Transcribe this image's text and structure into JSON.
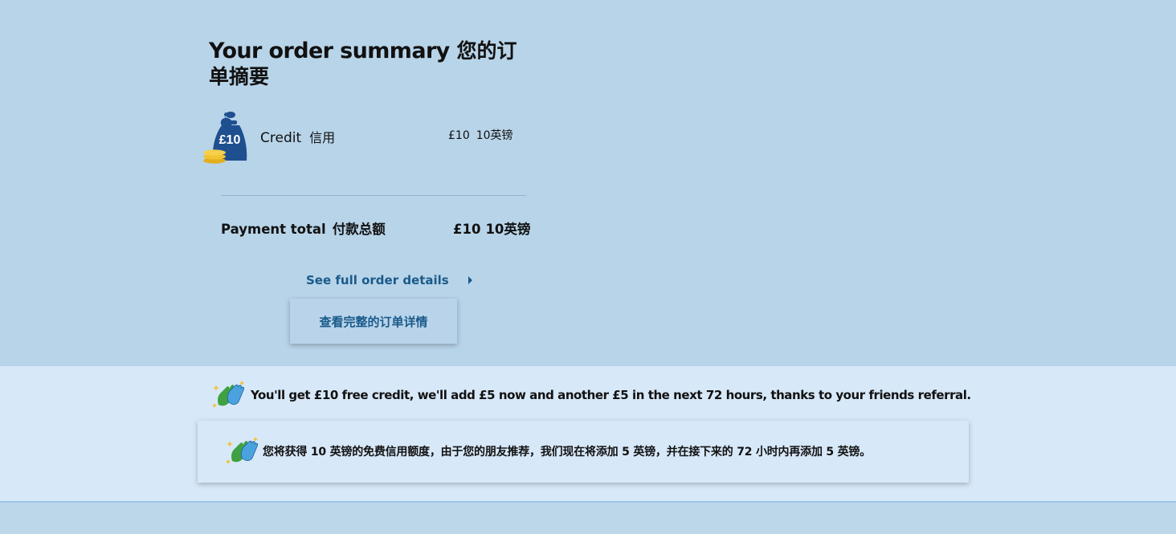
{
  "summary": {
    "title": "Your order summary",
    "title_zh": "您的订单摘要"
  },
  "item": {
    "icon": "money-bag-icon",
    "icon_text": "£10",
    "label": "Credit",
    "label_zh": "信用",
    "price": "£10",
    "price_zh": "10英镑"
  },
  "total": {
    "label": "Payment total",
    "label_zh": "付款总额",
    "value": "£10",
    "value_zh": "10英镑"
  },
  "details": {
    "link_label": "See full order details",
    "link_label_zh": "查看完整的订单详情"
  },
  "banner": {
    "icon": "high-five-icon",
    "message": "You'll get £10 free credit, we'll add £5 now and another £5 in the next 72 hours, thanks to your friends referral.",
    "message_zh": "您将获得 10 英镑的免费信用额度，由于您的朋友推荐，我们现在将添加 5 英镑，并在接下来的 72 小时内再添加 5 英镑。"
  },
  "colors": {
    "background": "#b8d4e9",
    "banner_background": "#d7e8f8",
    "link": "#1a5a8a",
    "bag": "#1e4f8f",
    "coin": "#f2c230"
  }
}
